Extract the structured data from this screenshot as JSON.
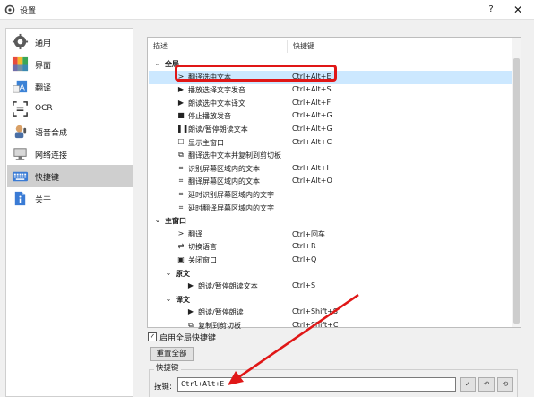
{
  "window": {
    "title": "设置",
    "help": "?",
    "close": "✕"
  },
  "sidebar": {
    "items": [
      {
        "label": "通用",
        "icon": "gear-icon"
      },
      {
        "label": "界面",
        "icon": "palette-icon"
      },
      {
        "label": "翻译",
        "icon": "translate-icon"
      },
      {
        "label": "OCR",
        "icon": "ocr-icon"
      },
      {
        "label": "语音合成",
        "icon": "speech-icon"
      },
      {
        "label": "网络连接",
        "icon": "network-icon"
      },
      {
        "label": "快捷键",
        "icon": "keyboard-icon",
        "active": true
      },
      {
        "label": "关于",
        "icon": "info-icon"
      }
    ]
  },
  "table": {
    "col_description": "描述",
    "col_shortcut": "快捷键",
    "rows": [
      {
        "label": "全局",
        "key": "",
        "group": true,
        "chev": "⌄"
      },
      {
        "label": "翻译选中文本",
        "key": "Ctrl+Alt+E",
        "icon": ">",
        "selected": true
      },
      {
        "label": "播放选择文字发音",
        "key": "Ctrl+Alt+S",
        "icon": "▶"
      },
      {
        "label": "朗读选中文本译文",
        "key": "Ctrl+Alt+F",
        "icon": "▶"
      },
      {
        "label": "停止播放发音",
        "key": "Ctrl+Alt+G",
        "icon": "■"
      },
      {
        "label": "朗读/暂停朗读文本",
        "key": "Ctrl+Alt+G",
        "icon": "❚❚"
      },
      {
        "label": "显示主窗口",
        "key": "Ctrl+Alt+C",
        "icon": "☐"
      },
      {
        "label": "翻译选中文本并复制到剪切板",
        "key": "",
        "icon": "⧉"
      },
      {
        "label": "识别屏幕区域内的文本",
        "key": "Ctrl+Alt+I",
        "icon": "⌗"
      },
      {
        "label": "翻译屏幕区域内的文本",
        "key": "Ctrl+Alt+O",
        "icon": "⌗"
      },
      {
        "label": "延时识别屏幕区域内的文字",
        "key": "",
        "icon": "⌗"
      },
      {
        "label": "延时翻译屏幕区域内的文字",
        "key": "",
        "icon": "⌗"
      },
      {
        "label": "主窗口",
        "key": "",
        "group": true,
        "chev": "⌄"
      },
      {
        "label": "翻译",
        "key": "Ctrl+回车",
        "icon": ">"
      },
      {
        "label": "切换语言",
        "key": "Ctrl+R",
        "icon": "⇄"
      },
      {
        "label": "关闭窗口",
        "key": "Ctrl+Q",
        "icon": "▣"
      },
      {
        "label": "原文",
        "key": "",
        "group": true,
        "chev": "⌄",
        "sub": true
      },
      {
        "label": "朗读/暂停朗读文本",
        "key": "Ctrl+S",
        "icon": "▶",
        "sub": true
      },
      {
        "label": "译文",
        "key": "",
        "group": true,
        "chev": "⌄",
        "sub": true
      },
      {
        "label": "朗读/暂停朗读",
        "key": "Ctrl+Shift+S",
        "icon": "▶",
        "sub": true
      },
      {
        "label": "复制到剪切板",
        "key": "Ctrl+Shift+C",
        "icon": "⧉",
        "sub": true
      }
    ]
  },
  "options": {
    "enable_global_label": "启用全局快捷键",
    "enable_global_checked": "✓",
    "reset_label": "重置全部"
  },
  "shortcut_group": {
    "title": "快捷键",
    "key_label": "按键:",
    "key_value": "Ctrl+Alt+E",
    "confirm": "✓",
    "clear": "↶",
    "reset": "⟲"
  },
  "colors": {
    "selection": "#cce8ff",
    "highlight": "#e01717",
    "active_sidebar": "#cfcfcf"
  }
}
